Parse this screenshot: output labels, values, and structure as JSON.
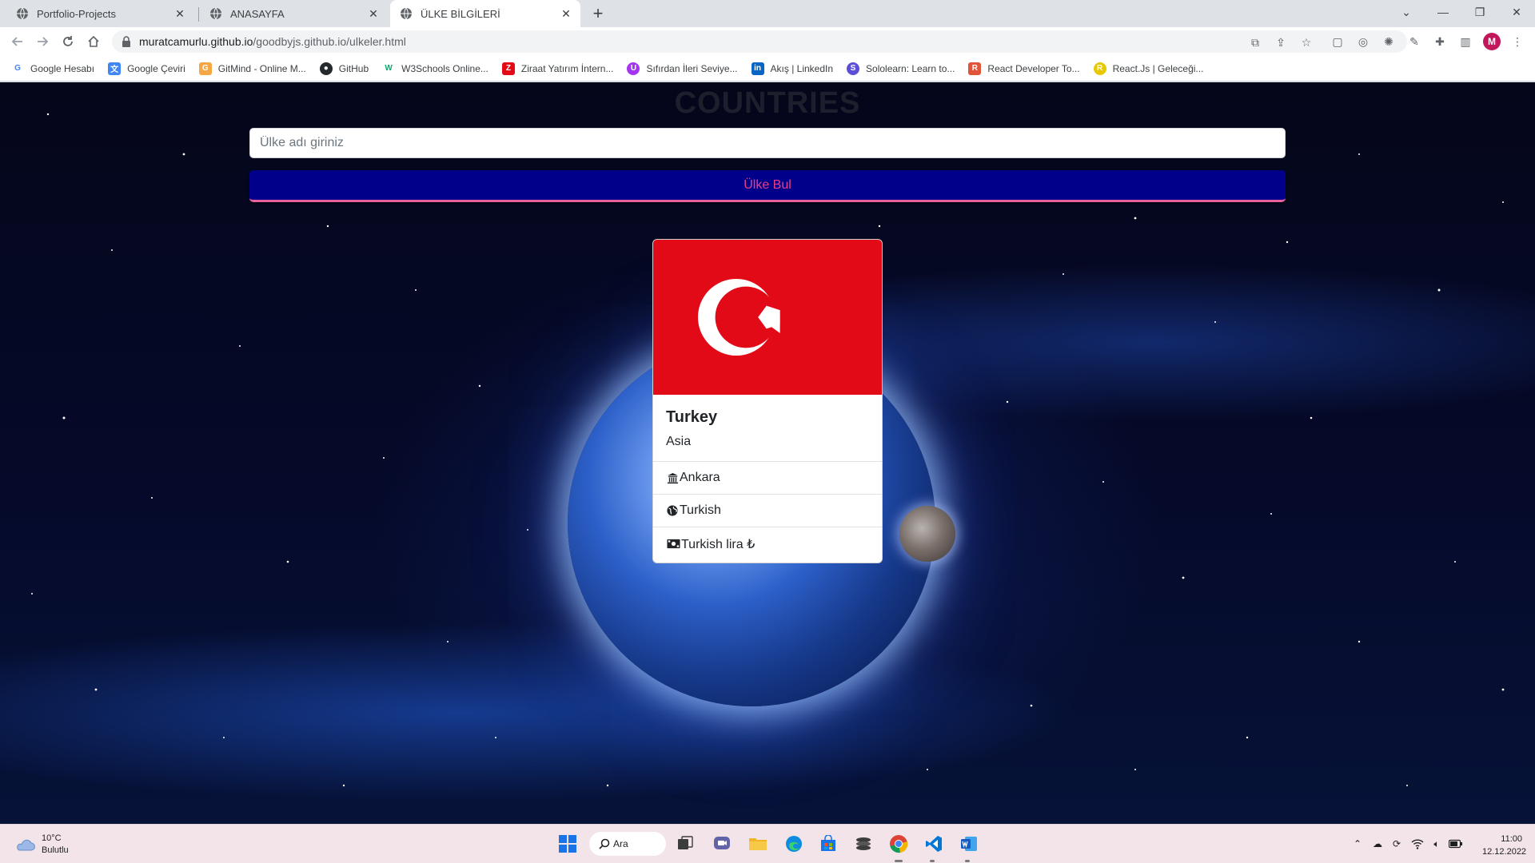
{
  "browser": {
    "tabs": [
      {
        "title": "Portfolio-Projects",
        "active": false
      },
      {
        "title": "ANASAYFA",
        "active": false
      },
      {
        "title": "ÜLKE BİLGİLERİ",
        "active": true
      }
    ],
    "url": {
      "host": "muratcamurlu.github.io",
      "path": "/goodbyjs.github.io/ulkeler.html"
    },
    "profile_initial": "M",
    "bookmarks": [
      {
        "label": "Google Hesabı",
        "icon": "google-icon",
        "color": "#4285f4",
        "glyph": "G"
      },
      {
        "label": "Google Çeviri",
        "icon": "translate-icon",
        "color": "#4285f4",
        "glyph": "文"
      },
      {
        "label": "GitMind - Online M...",
        "icon": "gitmind-icon",
        "color": "#f4a742",
        "glyph": "G"
      },
      {
        "label": "GitHub",
        "icon": "github-icon",
        "color": "#24292e",
        "glyph": "●"
      },
      {
        "label": "W3Schools Online...",
        "icon": "w3schools-icon",
        "color": "#04aa6d",
        "glyph": "W"
      },
      {
        "label": "Ziraat Yatırım İntern...",
        "icon": "ziraat-icon",
        "color": "#e30a17",
        "glyph": "Z"
      },
      {
        "label": "Sıfırdan İleri Seviye...",
        "icon": "udemy-icon",
        "color": "#a435f0",
        "glyph": "U"
      },
      {
        "label": "Akış | LinkedIn",
        "icon": "linkedin-icon",
        "color": "#0a66c2",
        "glyph": "in"
      },
      {
        "label": "Sololearn: Learn to...",
        "icon": "sololearn-icon",
        "color": "#5b4fd8",
        "glyph": "S"
      },
      {
        "label": "React Developer To...",
        "icon": "react-devtools-icon",
        "color": "#e0553a",
        "glyph": "R"
      },
      {
        "label": "React.Js | Geleceği...",
        "icon": "reactjs-icon",
        "color": "#e8c800",
        "glyph": "R"
      }
    ]
  },
  "page": {
    "title": "COUNTRIES",
    "search": {
      "placeholder": "Ülke adı giriniz",
      "value": ""
    },
    "button_label": "Ülke Bul",
    "card": {
      "flag": "turkey-flag",
      "name": "Turkey",
      "region": "Asia",
      "capital": "Ankara",
      "language": "Turkish",
      "currency": "Turkish lira ₺"
    }
  },
  "taskbar": {
    "weather_temp": "10°C",
    "weather_desc": "Bulutlu",
    "search_label": "Ara",
    "time": "11:00",
    "date": "12.12.2022"
  },
  "colors": {
    "button_bg": "#00008b",
    "button_text": "#e83e8c",
    "flag_red": "#e30a17"
  }
}
